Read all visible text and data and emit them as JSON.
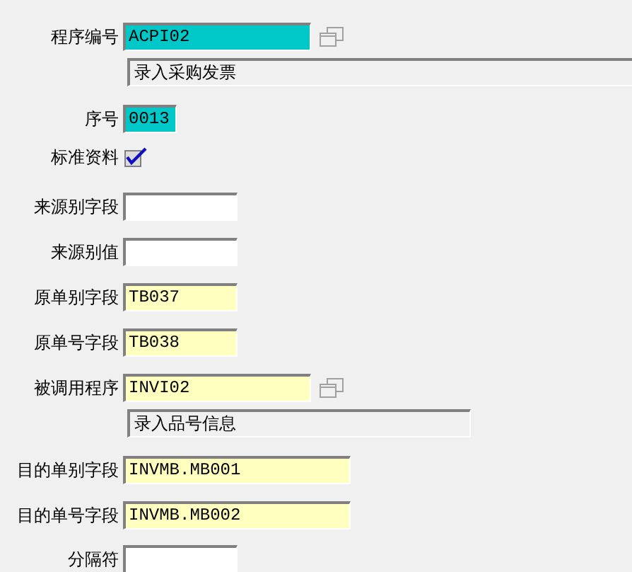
{
  "rows": [
    {
      "kind": "key_field",
      "label": "程序编号",
      "value": "ACPI02",
      "lookup": true,
      "description": "录入采购发票"
    },
    {
      "kind": "key_field",
      "label": "序号",
      "value": "0013"
    },
    {
      "kind": "checkbox",
      "label": "标准资料",
      "checked": true
    },
    {
      "kind": "text_field",
      "label": "来源别字段"
    },
    {
      "kind": "text_field",
      "label": "来源别值"
    },
    {
      "kind": "required_field",
      "label": "原单别字段",
      "value": "TB037"
    },
    {
      "kind": "required_field",
      "label": "原单号字段",
      "value": "TB038"
    },
    {
      "kind": "required_field",
      "label": "被调用程序",
      "value": "INVI02",
      "lookup": true,
      "description": "录入品号信息"
    },
    {
      "kind": "required_field",
      "label": "目的单别字段",
      "value": "INVMB.MB001"
    },
    {
      "kind": "required_field",
      "label": "目的单号字段",
      "value": "INVMB.MB002"
    },
    {
      "kind": "text_field",
      "label": "分隔符"
    }
  ]
}
